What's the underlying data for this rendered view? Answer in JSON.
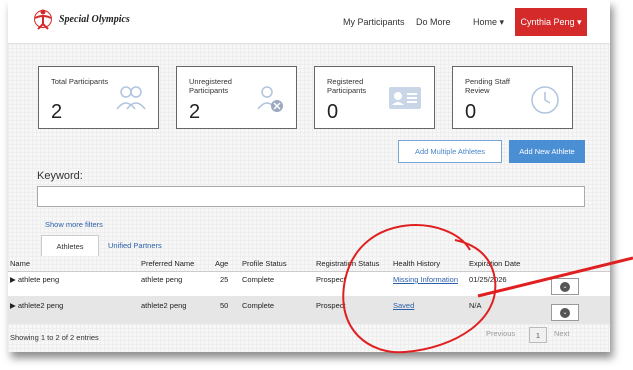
{
  "nav": {
    "logo_text": "Special Olympics",
    "links": [
      "My Participants",
      "Do More",
      "Home"
    ],
    "home_caret": "▾",
    "user_name": "Cynthia Peng",
    "user_caret": "▾"
  },
  "cards": [
    {
      "label": "Total Participants",
      "value": "2",
      "icon": "users-icon"
    },
    {
      "label": "Unregistered Participants",
      "value": "2",
      "icon": "user-remove-icon"
    },
    {
      "label": "Registered Participants",
      "value": "0",
      "icon": "id-card-icon"
    },
    {
      "label": "Pending Staff Review",
      "value": "0",
      "icon": "clock-icon"
    }
  ],
  "actions": {
    "add_multiple": "Add Multiple Athletes",
    "add_new": "Add New Athlete"
  },
  "search": {
    "keyword_label": "Keyword:",
    "placeholder": "",
    "show_more_filters": "Show more filters"
  },
  "tabs": [
    "Athletes",
    "Unified Partners"
  ],
  "table": {
    "headers": [
      "Name",
      "Preferred Name",
      "Age",
      "Profile Status",
      "Registration Status",
      "Health History",
      "Expiration Date"
    ],
    "rows": [
      {
        "name": "▶ athlete peng",
        "preferred": "athlete peng",
        "age": "25",
        "profile": "Complete",
        "registration": "Prospect",
        "health": "Missing Information",
        "expiration": "01/25/2026"
      },
      {
        "name": "▶ athlete2 peng",
        "preferred": "athlete2 peng",
        "age": "50",
        "profile": "Complete",
        "registration": "Prospect",
        "health": "Saved",
        "expiration": "N/A"
      }
    ]
  },
  "footer": {
    "entries": "Showing 1 to 2 of 2 entries",
    "previous": "Previous",
    "page": "1",
    "next": "Next"
  },
  "colors": {
    "brand_red": "#d42a2a",
    "primary_blue": "#4a8fd4",
    "link_blue": "#2d5fa8",
    "annotation_red": "#e02020"
  }
}
